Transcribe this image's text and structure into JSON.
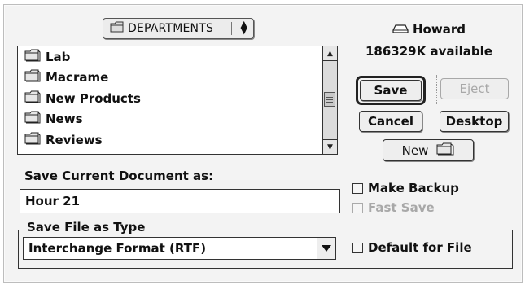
{
  "folder_popup": {
    "label": "DEPARTMENTS"
  },
  "disk": {
    "name": "Howard",
    "available": "186329K available"
  },
  "files": [
    {
      "name": "Lab"
    },
    {
      "name": "Macrame"
    },
    {
      "name": "New Products"
    },
    {
      "name": "News"
    },
    {
      "name": "Reviews"
    }
  ],
  "buttons": {
    "save": "Save",
    "eject": "Eject",
    "cancel": "Cancel",
    "desktop": "Desktop",
    "new": "New"
  },
  "save_as": {
    "label": "Save Current Document as:",
    "value": "Hour 21"
  },
  "options": {
    "make_backup": "Make Backup",
    "fast_save": "Fast Save",
    "default_for_file": "Default for File"
  },
  "file_type": {
    "group_label": "Save File as Type",
    "selected": "Interchange Format (RTF)"
  }
}
